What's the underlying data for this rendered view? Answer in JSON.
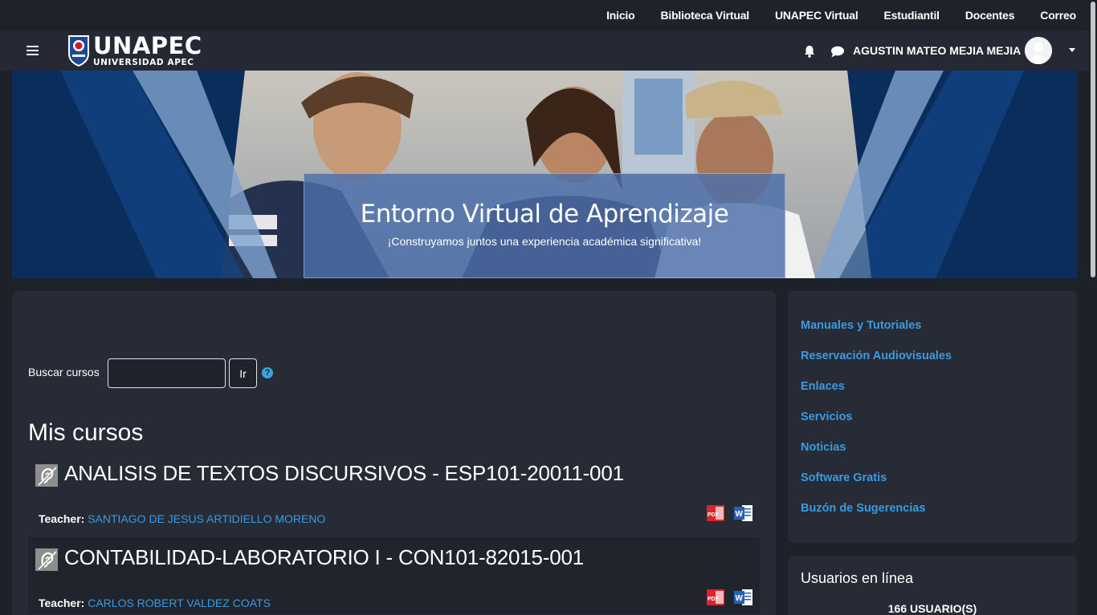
{
  "topbar": {
    "links": [
      "Inicio",
      "Biblioteca Virtual",
      "UNAPEC Virtual",
      "Estudiantil",
      "Docentes",
      "Correo"
    ]
  },
  "navbar": {
    "logo_main": "UNAPEC",
    "logo_sub": "UNIVERSIDAD APEC",
    "user_name": "AGUSTIN MATEO MEJIA MEJIA"
  },
  "hero": {
    "title": "Entorno Virtual de Aprendizaje",
    "subtitle": "¡Construyamos juntos una experiencia académica significativa!"
  },
  "search": {
    "label": "Buscar cursos",
    "value": "",
    "button": "Ir",
    "help": "?"
  },
  "main": {
    "heading": "Mis cursos",
    "courses": [
      {
        "title": "ANALISIS DE TEXTOS DISCURSIVOS - ESP101-20011-001",
        "teacher_label": "Teacher:",
        "teacher_name": "SANTIAGO DE JESUS ARTIDIELLO MORENO"
      },
      {
        "title": "CONTABILIDAD-LABORATORIO I - CON101-82015-001",
        "teacher_label": "Teacher:",
        "teacher_name": "CARLOS ROBERT VALDEZ COATS"
      }
    ]
  },
  "sidebar": {
    "links": [
      "Manuales y Tutoriales",
      "Reservación Audiovisuales",
      "Enlaces",
      "Servicios",
      "Noticias",
      "Software Gratis",
      "Buzón de Sugerencias"
    ],
    "online_title": "Usuarios en línea",
    "online_count": "166 USUARIO(S)"
  },
  "colors": {
    "background": "#1d2129",
    "card": "#262b35",
    "link": "#3b9ae1",
    "hero_blue": "#0b2f5e"
  }
}
